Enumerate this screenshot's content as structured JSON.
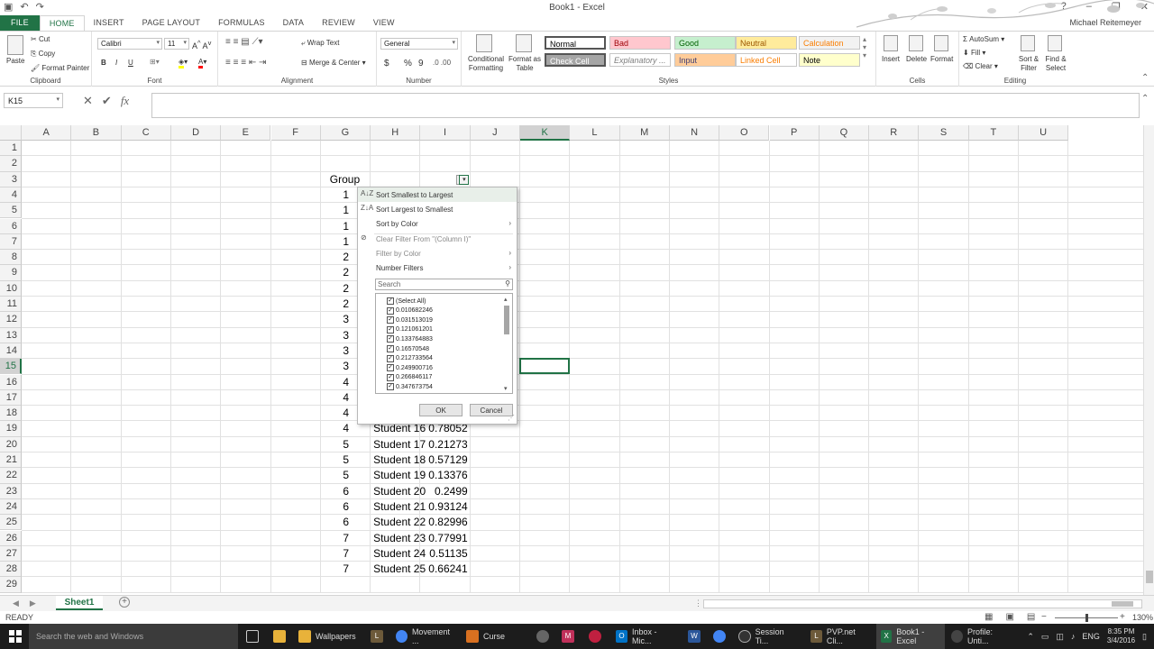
{
  "window": {
    "title": "Book1 - Excel",
    "user": "Michael Reitemeyer",
    "controls": [
      "?",
      "–",
      "❐",
      "✕"
    ]
  },
  "qat": [
    "▣",
    "↶",
    "↷"
  ],
  "tabs": [
    "FILE",
    "HOME",
    "INSERT",
    "PAGE LAYOUT",
    "FORMULAS",
    "DATA",
    "REVIEW",
    "VIEW"
  ],
  "ribbon": {
    "clipboard": {
      "paste": "Paste",
      "cut": "Cut",
      "copy": "Copy",
      "format_painter": "Format Painter",
      "label": "Clipboard"
    },
    "font": {
      "name": "Calibri",
      "size": "11",
      "bold": "B",
      "italic": "I",
      "underline": "U",
      "label": "Font"
    },
    "alignment": {
      "wrap": "Wrap Text",
      "merge": "Merge & Center",
      "label": "Alignment"
    },
    "number": {
      "format": "General",
      "currency": "$",
      "percent": "%",
      "comma": "9",
      "label": "Number"
    },
    "styles": {
      "conditional": "Conditional Formatting",
      "format_table": "Format as Table",
      "cells": [
        {
          "text": "Normal",
          "bg": "#ffffff",
          "fg": "#000000"
        },
        {
          "text": "Bad",
          "bg": "#ffc7ce",
          "fg": "#9c0006"
        },
        {
          "text": "Good",
          "bg": "#c6efce",
          "fg": "#006100"
        },
        {
          "text": "Neutral",
          "bg": "#ffeb9c",
          "fg": "#9c5700"
        },
        {
          "text": "Calculation",
          "bg": "#f2f2f2",
          "fg": "#fa7d00"
        },
        {
          "text": "Check Cell",
          "bg": "#a5a5a5",
          "fg": "#ffffff"
        },
        {
          "text": "Explanatory ...",
          "bg": "#ffffff",
          "fg": "#7f7f7f"
        },
        {
          "text": "Input",
          "bg": "#ffcc99",
          "fg": "#3f3f76"
        },
        {
          "text": "Linked Cell",
          "bg": "#ffffff",
          "fg": "#fa7d00"
        },
        {
          "text": "Note",
          "bg": "#ffffcc",
          "fg": "#000000"
        }
      ],
      "label": "Styles"
    },
    "cells": {
      "insert": "Insert",
      "delete": "Delete",
      "format": "Format",
      "label": "Cells"
    },
    "editing": {
      "autosum": "AutoSum",
      "fill": "Fill",
      "clear": "Clear",
      "sort_filter": "Sort & Filter",
      "find_select": "Find & Select",
      "label": "Editing"
    }
  },
  "formula_bar": {
    "name_box": "K15",
    "cancel": "✕",
    "enter": "✔",
    "fx": "fx",
    "value": ""
  },
  "columns": [
    "A",
    "B",
    "C",
    "D",
    "E",
    "F",
    "G",
    "H",
    "I",
    "J",
    "K",
    "L",
    "M",
    "N",
    "O",
    "P",
    "Q",
    "R",
    "S",
    "T",
    "U"
  ],
  "rows": [
    "1",
    "2",
    "3",
    "4",
    "5",
    "6",
    "7",
    "8",
    "9",
    "10",
    "11",
    "12",
    "13",
    "14",
    "15",
    "16",
    "17",
    "18",
    "19",
    "20",
    "21",
    "22",
    "23",
    "24",
    "25",
    "26",
    "27",
    "28",
    "29"
  ],
  "sheet": {
    "header_g": "Group",
    "group_values": [
      "1",
      "1",
      "1",
      "1",
      "2",
      "2",
      "2",
      "2",
      "3",
      "3",
      "3",
      "3",
      "4",
      "4",
      "4",
      "4",
      "5",
      "5",
      "5",
      "6",
      "6",
      "6",
      "7",
      "7",
      "7"
    ],
    "visible_rows": [
      {
        "name": "Student 16",
        "value": "0.78052"
      },
      {
        "name": "Student 17",
        "value": "0.21273"
      },
      {
        "name": "Student 18",
        "value": "0.57129"
      },
      {
        "name": "Student 19",
        "value": "0.13376"
      },
      {
        "name": "Student 20",
        "value": "0.2499"
      },
      {
        "name": "Student 21",
        "value": "0.93124"
      },
      {
        "name": "Student 22",
        "value": "0.82996"
      },
      {
        "name": "Student 23",
        "value": "0.77991"
      },
      {
        "name": "Student 24",
        "value": "0.51135"
      },
      {
        "name": "Student 25",
        "value": "0.66241"
      }
    ]
  },
  "filter_menu": {
    "sort_asc": "Sort Smallest to Largest",
    "sort_desc": "Sort Largest to Smallest",
    "sort_color": "Sort by Color",
    "clear_filter": "Clear Filter From \"(Column I)\"",
    "filter_color": "Filter by Color",
    "number_filters": "Number Filters",
    "search_placeholder": "Search",
    "items": [
      "(Select All)",
      "0.010682246",
      "0.031513019",
      "0.121061201",
      "0.133764883",
      "0.16570548",
      "0.212733564",
      "0.249900716",
      "0.266846117",
      "0.347673754"
    ],
    "ok": "OK",
    "cancel": "Cancel"
  },
  "sheet_tabs": {
    "active": "Sheet1"
  },
  "status": {
    "text": "READY",
    "zoom": "130%"
  },
  "taskbar": {
    "search": "Search the web and Windows",
    "items": [
      "Wallpapers",
      "Movement ...",
      "Curse",
      "Inbox - Mic...",
      "Session Ti...",
      "PVP.net Cli...",
      "Book1 - Excel",
      "Profile: Unti..."
    ],
    "lang": "ENG",
    "time": "8:35 PM",
    "date": "3/4/2016"
  }
}
